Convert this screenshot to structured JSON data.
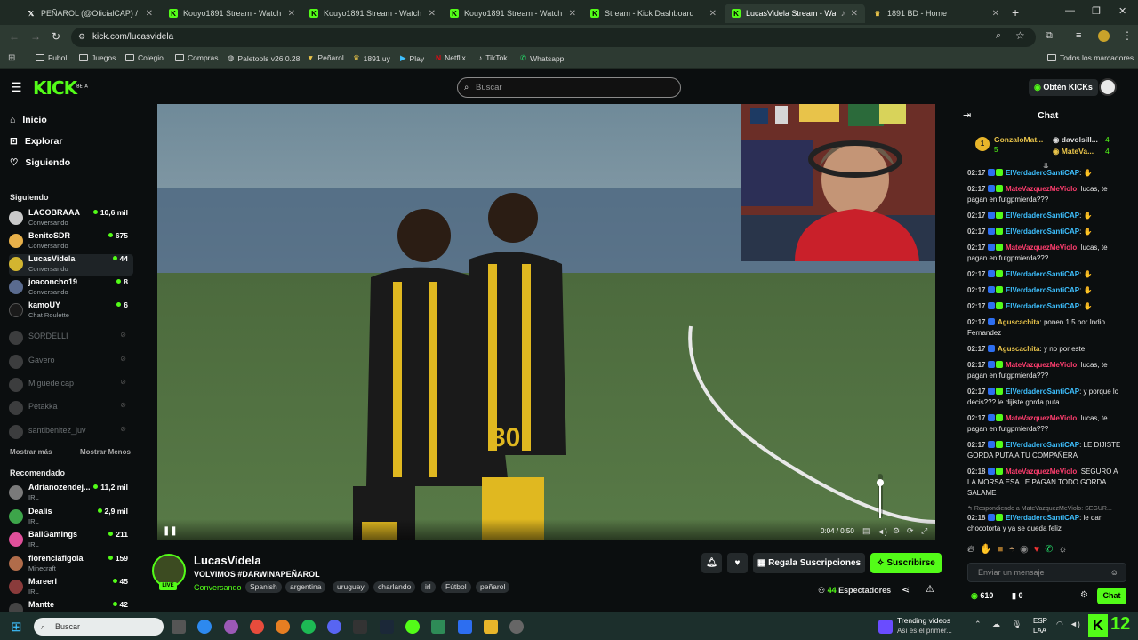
{
  "browser": {
    "tabs": [
      {
        "title": "PEÑAROL (@OficialCAP) / X",
        "icon": "x-icon"
      },
      {
        "title": "Kouyo1891 Stream - Watch Live",
        "icon": "kick-icon"
      },
      {
        "title": "Kouyo1891 Stream - Watch Live",
        "icon": "kick-icon"
      },
      {
        "title": "Kouyo1891 Stream - Watch Live",
        "icon": "kick-icon"
      },
      {
        "title": "Stream - Kick Dashboard",
        "icon": "kick-icon"
      },
      {
        "title": "LucasVidela Stream - Watch",
        "icon": "kick-icon"
      },
      {
        "title": "1891 BD - Home",
        "icon": "trophy-icon"
      }
    ],
    "url": "kick.com/lucasvidela",
    "bookmarks": [
      "Fubol",
      "Juegos",
      "Colegio",
      "Compras",
      "Paletools v26.0.28",
      "Peñarol",
      "1891.uy",
      "Play",
      "Netflix",
      "TikTok",
      "Whatsapp"
    ],
    "all_bookmarks": "Todos los marcadores"
  },
  "header": {
    "logo": "KICK",
    "logo_sup": "BETA",
    "search_placeholder": "Buscar",
    "get_kicks": "Obtén KICKs"
  },
  "sidebar": {
    "nav": [
      "Inicio",
      "Explorar",
      "Siguiendo"
    ],
    "following_title": "Siguiendo",
    "following": [
      {
        "name": "LACOBRAAA",
        "sub": "Conversando",
        "viewers": "10,6 mil",
        "color": "#c9c9c9"
      },
      {
        "name": "BenitoSDR",
        "sub": "Conversando",
        "viewers": "675",
        "color": "#e8b14a"
      },
      {
        "name": "LucasVidela",
        "sub": "Conversando",
        "viewers": "44",
        "color": "#d2b530"
      },
      {
        "name": "joaconcho19",
        "sub": "Conversando",
        "viewers": "8",
        "color": "#5a6b8f"
      },
      {
        "name": "kamoUY",
        "sub": "Chat Roulette",
        "viewers": "6",
        "color": "#1a1a1a"
      }
    ],
    "offline": [
      "SORDELLI",
      "Gavero",
      "Miguedelcap",
      "Petakka",
      "santibenitez_juv"
    ],
    "show_more": "Mostrar más",
    "show_less": "Mostrar Menos",
    "recommended_title": "Recomendado",
    "recommended": [
      {
        "name": "Adrianozendej...",
        "sub": "IRL",
        "viewers": "11,2 mil",
        "color": "#7a7a7a"
      },
      {
        "name": "Dealis",
        "sub": "IRL",
        "viewers": "2,9 mil",
        "color": "#3da54a"
      },
      {
        "name": "BallGamings",
        "sub": "IRL",
        "viewers": "211",
        "color": "#e04f9a"
      },
      {
        "name": "florenciafigola",
        "sub": "Minecraft",
        "viewers": "159",
        "color": "#b06c4a"
      },
      {
        "name": "Mareerl",
        "sub": "IRL",
        "viewers": "45",
        "color": "#8a3b3b"
      },
      {
        "name": "Mantte",
        "sub": "",
        "viewers": "42",
        "color": "#444"
      }
    ]
  },
  "player": {
    "time": "0:04 / 0:50",
    "progress_fraction": 0.08,
    "volume_fraction": 0.8
  },
  "stream": {
    "streamer": "LucasVidela",
    "title": "VOLVIMOS #DARWINAPEÑAROL",
    "category": "Conversando",
    "tags": [
      "Spanish",
      "argentina",
      "uruguay",
      "charlando",
      "irl",
      "Fútbol",
      "peñarol"
    ],
    "live_label": "LIVE",
    "gift_label": "Regala Suscripciones",
    "subscribe_label": "Suscribirse",
    "viewers": "44",
    "viewers_label": "Espectadores"
  },
  "chat": {
    "title": "Chat",
    "leaders": [
      {
        "rank": "1",
        "name": "GonzaloMat...",
        "count": "5"
      },
      {
        "name": "davolsill...",
        "count": "4"
      },
      {
        "name": "MateVa...",
        "count": "4"
      }
    ],
    "messages": [
      {
        "time": "02:17",
        "user": "ElVerdaderoSantiCAP",
        "cls": "ub",
        "text": "",
        "emote": true
      },
      {
        "time": "02:17",
        "user": "MateVazquezMeViolo",
        "cls": "up",
        "text": "lucas, te pagan en futgpmierda???"
      },
      {
        "time": "02:17",
        "user": "ElVerdaderoSantiCAP",
        "cls": "ub",
        "text": "",
        "emote": true
      },
      {
        "time": "02:17",
        "user": "ElVerdaderoSantiCAP",
        "cls": "ub",
        "text": "",
        "emote": true
      },
      {
        "time": "02:17",
        "user": "MateVazquezMeViolo",
        "cls": "up",
        "text": "lucas, te pagan en futgpmierda???"
      },
      {
        "time": "02:17",
        "user": "ElVerdaderoSantiCAP",
        "cls": "ub",
        "text": "",
        "emote": true
      },
      {
        "time": "02:17",
        "user": "ElVerdaderoSantiCAP",
        "cls": "ub",
        "text": "",
        "emote": true
      },
      {
        "time": "02:17",
        "user": "ElVerdaderoSantiCAP",
        "cls": "ub",
        "text": "",
        "emote": true
      },
      {
        "time": "02:17",
        "user": "Aguscachita",
        "cls": "uy",
        "text": "ponen 1.5 por Indio Fernandez"
      },
      {
        "time": "02:17",
        "user": "Aguscachita",
        "cls": "uy",
        "text": "y no por este"
      },
      {
        "time": "02:17",
        "user": "MateVazquezMeViolo",
        "cls": "up",
        "text": "lucas, te pagan en futgpmierda???"
      },
      {
        "time": "02:17",
        "user": "ElVerdaderoSantiCAP",
        "cls": "ub",
        "text": "y porque lo decis??? le dijiste gorda puta"
      },
      {
        "time": "02:17",
        "user": "MateVazquezMeViolo",
        "cls": "up",
        "text": "lucas, te pagan en futgpmierda???"
      },
      {
        "time": "02:17",
        "user": "ElVerdaderoSantiCAP",
        "cls": "ub",
        "text": "LE DIJISTE GORDA PUTA A TU COMPAÑERA"
      },
      {
        "time": "02:18",
        "user": "MateVazquezMeViolo",
        "cls": "up",
        "text": "SEGURO A LA MORSA ESA LE PAGAN TODO GORDA SALAME"
      },
      {
        "time": "02:18",
        "user": "ElVerdaderoSantiCAP",
        "cls": "ub",
        "text": "le dan chocotorta y ya se queda feliz"
      }
    ],
    "reply_note": "Respondiendo a MateVazquezMeViolo: SEGUR...",
    "input_placeholder": "Enviar un mensaje",
    "kicks": "610",
    "points": "0",
    "send_label": "Chat"
  },
  "taskbar": {
    "search_placeholder": "Buscar",
    "news_title": "Trending videos",
    "news_sub": "Así es el primer...",
    "lang": "ESP",
    "lang2": "LAA",
    "clock": "12"
  }
}
